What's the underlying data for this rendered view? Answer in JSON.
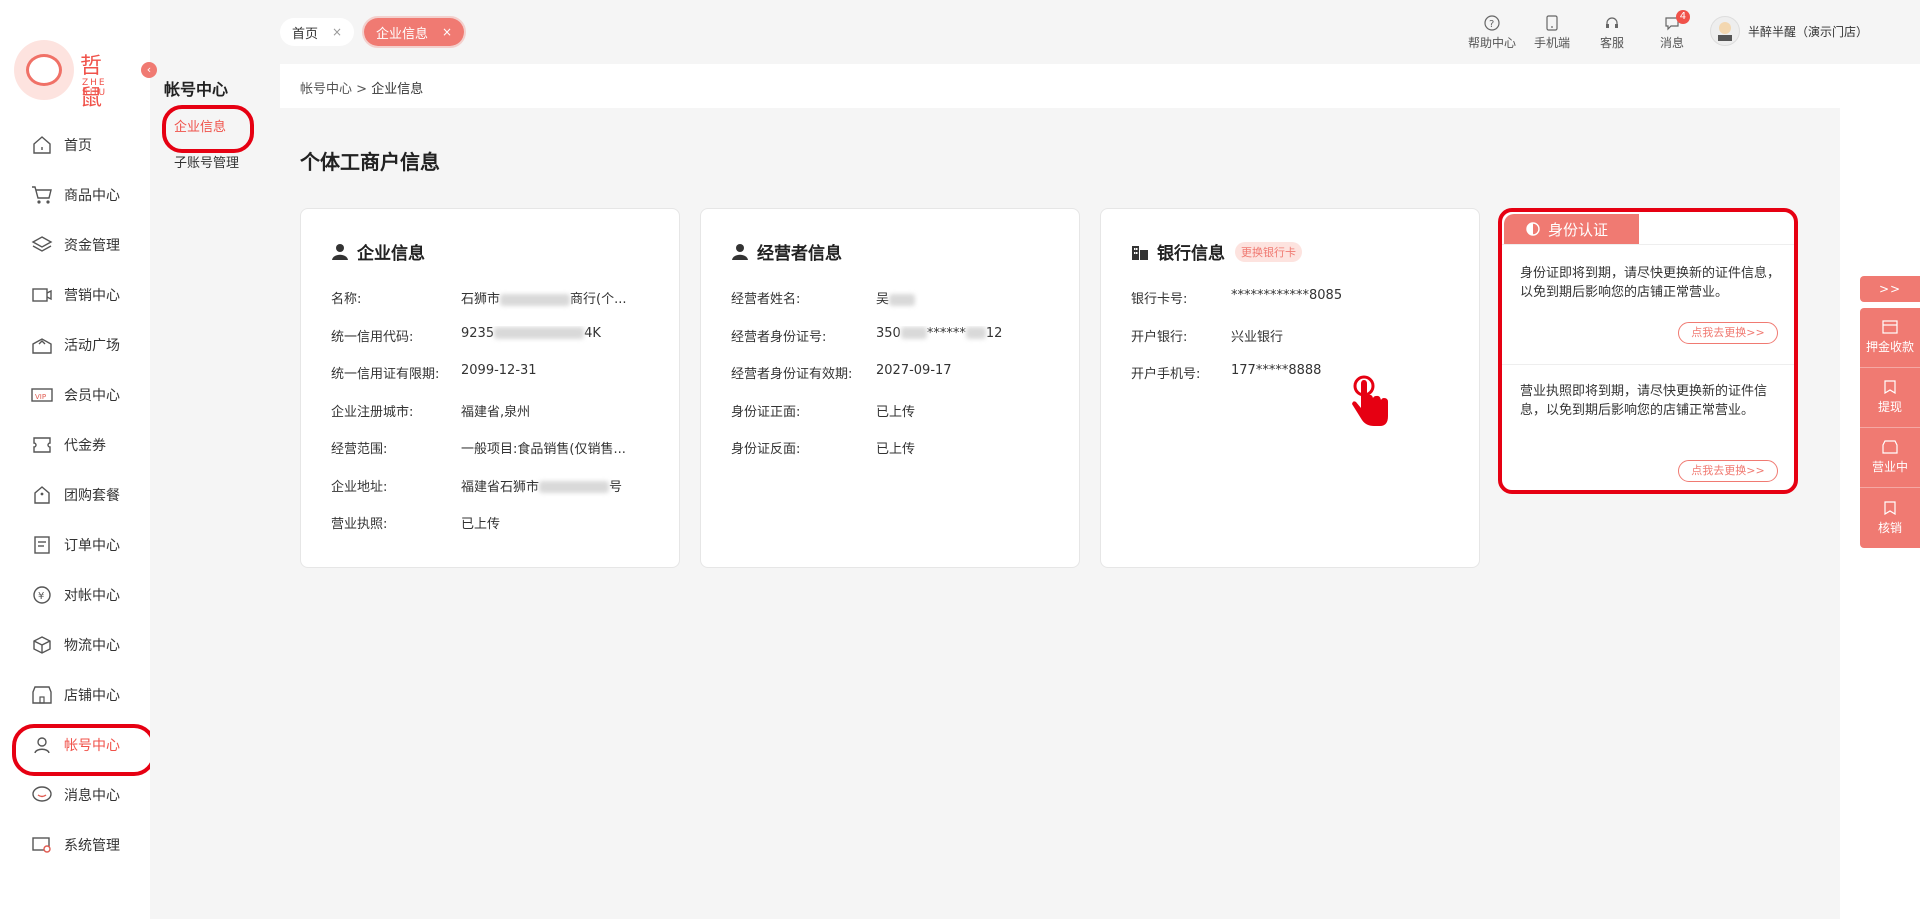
{
  "brand": {
    "logo_text": "哲鼠",
    "logo_sub": "ZHE SHU"
  },
  "nav": [
    {
      "label": "首页",
      "icon": "home-icon"
    },
    {
      "label": "商品中心",
      "icon": "cart-icon"
    },
    {
      "label": "资金管理",
      "icon": "layers-icon"
    },
    {
      "label": "营销中心",
      "icon": "marketing-icon"
    },
    {
      "label": "活动广场",
      "icon": "activity-icon"
    },
    {
      "label": "会员中心",
      "icon": "vip-icon"
    },
    {
      "label": "代金券",
      "icon": "voucher-icon"
    },
    {
      "label": "团购套餐",
      "icon": "group-buy-icon"
    },
    {
      "label": "订单中心",
      "icon": "order-icon"
    },
    {
      "label": "对帐中心",
      "icon": "reconcile-icon"
    },
    {
      "label": "物流中心",
      "icon": "logistics-icon"
    },
    {
      "label": "店铺中心",
      "icon": "store-icon"
    },
    {
      "label": "帐号中心",
      "icon": "account-icon",
      "active": true
    },
    {
      "label": "消息中心",
      "icon": "message-icon"
    },
    {
      "label": "系统管理",
      "icon": "system-icon"
    }
  ],
  "subnav": {
    "title": "帐号中心",
    "items": [
      {
        "label": "企业信息",
        "active": true
      },
      {
        "label": "子账号管理"
      }
    ]
  },
  "tabs": [
    {
      "label": "首页",
      "close": "×"
    },
    {
      "label": "企业信息",
      "close": "×"
    }
  ],
  "toolbar": {
    "help": "帮助中心",
    "mobile": "手机端",
    "service": "客服",
    "messages": "消息",
    "message_count": "4",
    "user_name": "半醉半醒（演示门店）"
  },
  "breadcrumb": {
    "root": "帐号中心",
    "sep": ">",
    "current": "企业信息"
  },
  "page_title": "个体工商户信息",
  "enterprise": {
    "title": "企业信息",
    "rows": [
      {
        "k": "名称:",
        "v_pre": "石狮市",
        "v_post": "商行(个..."
      },
      {
        "k": "统一信用代码:",
        "v_pre": "9235",
        "v_post": "4K"
      },
      {
        "k": "统一信用证有限期:",
        "v_pre": "2099-12-31",
        "v_post": ""
      },
      {
        "k": "企业注册城市:",
        "v_pre": "福建省,泉州",
        "v_post": ""
      },
      {
        "k": "经营范围:",
        "v_pre": "一般项目:食品销售(仅销售...",
        "v_post": ""
      },
      {
        "k": "企业地址:",
        "v_pre": "福建省石狮市",
        "v_post": "号"
      },
      {
        "k": "营业执照:",
        "v_pre": "已上传",
        "v_post": ""
      }
    ]
  },
  "operator": {
    "title": "经营者信息",
    "rows": [
      {
        "k": "经营者姓名:",
        "v_pre": "吴",
        "v_post": ""
      },
      {
        "k": "经营者身份证号:",
        "v_pre": "350",
        "v_post": "******",
        "v_tail": "12"
      },
      {
        "k": "经营者身份证有效期:",
        "v_pre": "2027-09-17",
        "v_post": ""
      },
      {
        "k": "身份证正面:",
        "v_pre": "已上传",
        "v_post": ""
      },
      {
        "k": "身份证反面:",
        "v_pre": "已上传",
        "v_post": ""
      }
    ]
  },
  "bank": {
    "title": "银行信息",
    "change_label": "更换银行卡",
    "rows": [
      {
        "k": "银行卡号:",
        "v": "************8085"
      },
      {
        "k": "开户银行:",
        "v": "兴业银行"
      },
      {
        "k": "开户手机号:",
        "v": "177*****8888"
      }
    ]
  },
  "identity": {
    "title": "身份认证",
    "notices": [
      {
        "text": "身份证即将到期，请尽快更换新的证件信息，以免到期后影响您的店铺正常营业。",
        "button": "点我去更换>>"
      },
      {
        "text": "营业执照即将到期，请尽快更换新的证件信息，以免到期后影响您的店铺正常营业。",
        "button": "点我去更换>>"
      }
    ]
  },
  "float_panel": {
    "expand": ">>",
    "items": [
      {
        "label": "押金收款",
        "icon": "deposit-icon"
      },
      {
        "label": "提现",
        "icon": "withdraw-icon"
      },
      {
        "label": "营业中",
        "icon": "open-store-icon"
      },
      {
        "label": "核销",
        "icon": "verify-icon"
      }
    ]
  },
  "colors": {
    "accent": "#f07a72",
    "highlight_red": "#e60012",
    "text": "#333333"
  }
}
